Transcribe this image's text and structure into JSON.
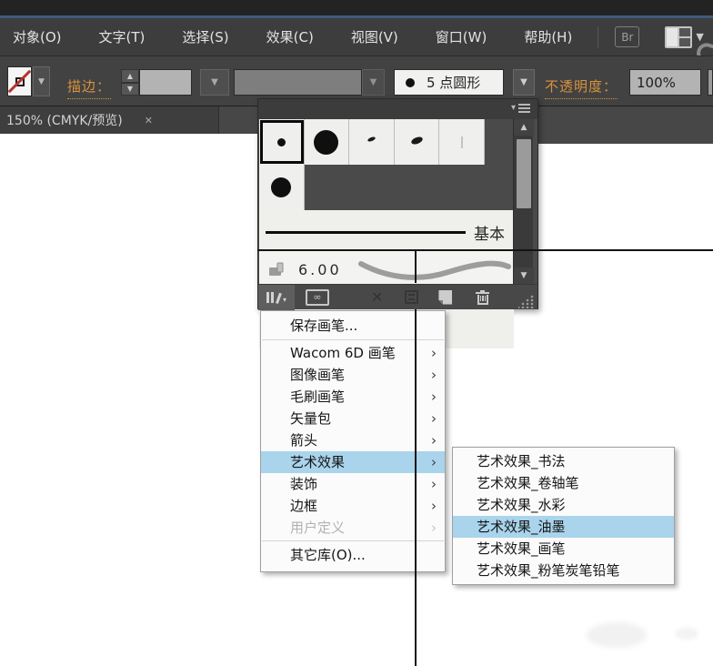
{
  "menu_bar": {
    "items": [
      {
        "label": "对象(O)"
      },
      {
        "label": "文字(T)"
      },
      {
        "label": "选择(S)"
      },
      {
        "label": "效果(C)"
      },
      {
        "label": "视图(V)"
      },
      {
        "label": "窗口(W)"
      },
      {
        "label": "帮助(H)"
      }
    ],
    "bridge_label": "Br"
  },
  "control_bar": {
    "stroke_label": "描边：",
    "brush_definition_value": "5 点圆形",
    "opacity_label": "不透明度：",
    "opacity_value": "100%"
  },
  "tab_bar": {
    "document_tab": "150% (CMYK/预览)"
  },
  "brushes_panel": {
    "basic_brush_label": "基本",
    "calligraphic_brush_size": "6.00"
  },
  "menu": {
    "items": [
      {
        "label": "保存画笔..."
      },
      {
        "label": "Wacom 6D 画笔"
      },
      {
        "label": "图像画笔"
      },
      {
        "label": "毛刷画笔"
      },
      {
        "label": "矢量包"
      },
      {
        "label": "箭头"
      },
      {
        "label": "艺术效果"
      },
      {
        "label": "装饰"
      },
      {
        "label": "边框"
      },
      {
        "label": "用户定义"
      },
      {
        "label": "其它库(O)..."
      }
    ]
  },
  "submenu": {
    "items": [
      {
        "label": "艺术效果_书法"
      },
      {
        "label": "艺术效果_卷轴笔"
      },
      {
        "label": "艺术效果_水彩"
      },
      {
        "label": "艺术效果_油墨"
      },
      {
        "label": "艺术效果_画笔"
      },
      {
        "label": "艺术效果_粉笔炭笔铅笔"
      }
    ]
  },
  "icons": {
    "chevron": "›",
    "down_arrow": "▼",
    "up_arrow": "▲",
    "small_caret": "▾",
    "close": "✕",
    "x_mark": "✕",
    "cc_link": "∞"
  },
  "colors": {
    "highlight_blue": "#a9d4ec",
    "accent_orange": "#d9913c",
    "panel_dark": "#4a4a4a",
    "chrome_dark": "#3d3d3d"
  }
}
